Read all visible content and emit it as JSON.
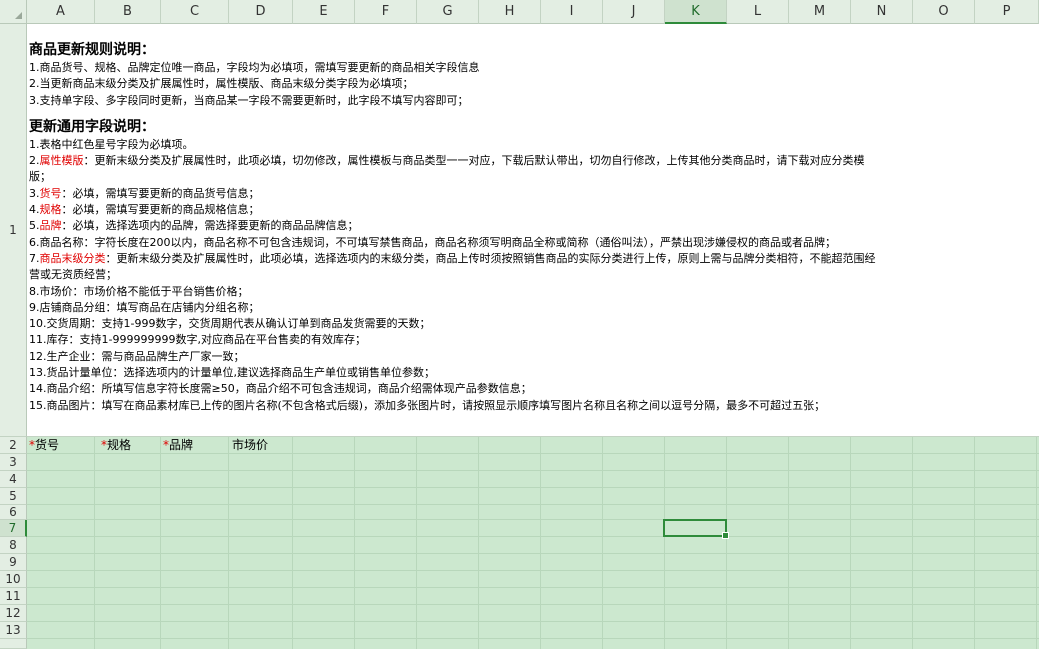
{
  "columns": [
    "A",
    "B",
    "C",
    "D",
    "E",
    "F",
    "G",
    "H",
    "I",
    "J",
    "K",
    "L",
    "M",
    "N",
    "O",
    "P"
  ],
  "rows": [
    "1",
    "2",
    "3",
    "4",
    "5",
    "6",
    "7",
    "8",
    "9",
    "10",
    "11",
    "12",
    "13"
  ],
  "selected_column": "K",
  "selected_row": "7",
  "instructions": {
    "title1": "商品更新规则说明：",
    "rules": [
      "1.商品货号、规格、品牌定位唯一商品，字段均为必填项，需填写要更新的商品相关字段信息",
      "2.当更新商品末级分类及扩展属性时，属性模版、商品末级分类字段为必填项；",
      "3.支持单字段、多字段同时更新，当商品某一字段不需要更新时，此字段不填写内容即可；"
    ],
    "title2": "更新通用字段说明：",
    "f1": "1.表格中红色星号字段为必填项。",
    "f2_num": "2.",
    "f2_key": "属性模版",
    "f2_rest": "：更新末级分类及扩展属性时，此项必填，切勿修改，属性模板与商品类型一一对应，下载后默认带出，切勿自行修改，上传其他分类商品时，请下载对应分类模",
    "f2_wrap": "版；",
    "f3_num": "3.",
    "f3_key": "货号",
    "f3_rest": "：必填，需填写要更新的商品货号信息；",
    "f4_num": "4.",
    "f4_key": "规格",
    "f4_rest": "：必填，需填写要更新的商品规格信息；",
    "f5_num": "5.",
    "f5_key": "品牌",
    "f5_rest": "：必填，选择选项内的品牌，需选择要更新的商品品牌信息；",
    "f6": "6.商品名称：字符长度在200以内，商品名称不可包含违规词，不可填写禁售商品，商品名称须写明商品全称或简称（通俗叫法），严禁出现涉嫌侵权的商品或者品牌；",
    "f7_num": "7.",
    "f7_key": "商品末级分类",
    "f7_rest": "：更新末级分类及扩展属性时，此项必填，选择选项内的末级分类，商品上传时须按照销售商品的实际分类进行上传，原则上需与品牌分类相符，不能超范围经",
    "f7_wrap": "营或无资质经营；",
    "f8": "8.市场价：市场价格不能低于平台销售价格；",
    "f9": "9.店铺商品分组：填写商品在店铺内分组名称；",
    "f10": "10.交货周期：支持1-999数字，交货周期代表从确认订单到商品发货需要的天数；",
    "f11": "11.库存：支持1-999999999数字,对应商品在平台售卖的有效库存；",
    "f12": "12.生产企业：需与商品品牌生产厂家一致；",
    "f13": "13.货品计量单位：选择选项内的计量单位,建议选择商品生产单位或销售单位参数；",
    "f14": "14.商品介绍：所填写信息字符长度需≥50，商品介绍不可包含违规词，商品介绍需体现产品参数信息；",
    "f15": "15.商品图片：填写在商品素材库已上传的图片名称(不包含格式后缀)，添加多张图片时，请按照显示顺序填写图片名称且名称之间以逗号分隔，最多不可超过五张；"
  },
  "header_row": {
    "star": "*",
    "huohao": "货号",
    "guige": "规格",
    "pinpai": "品牌",
    "shichangjia": "市场价"
  }
}
